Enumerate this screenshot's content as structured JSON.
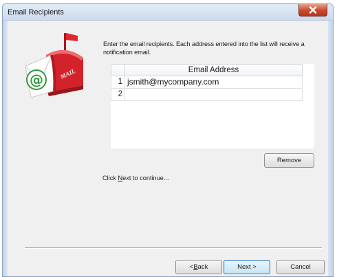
{
  "window": {
    "title": "Email Recipients"
  },
  "content": {
    "instructions": "Enter the email recipients. Each address entered into the list will receive a notification email.",
    "grid": {
      "header": "Email Address",
      "rows": [
        {
          "num": "1",
          "email": "jsmith@mycompany.com"
        },
        {
          "num": "2",
          "email": ""
        }
      ]
    },
    "remove_label": "Remove",
    "continue_prefix": "Click ",
    "continue_key": "N",
    "continue_word_rest": "ext",
    "continue_suffix": " to continue..."
  },
  "art": {
    "mailbox_text": "MAIL"
  },
  "footer": {
    "back_prefix": "< ",
    "back_key": "B",
    "back_rest": "ack",
    "next_label": "Next >",
    "cancel_label": "Cancel"
  },
  "colors": {
    "mailbox_red": "#d2232a",
    "title_bar": "#cbdaec",
    "close_button": "#c9492f",
    "at_sign_green": "#2e9a3c"
  },
  "icons": {
    "close": "close-icon",
    "mailbox": "mailbox-icon"
  }
}
